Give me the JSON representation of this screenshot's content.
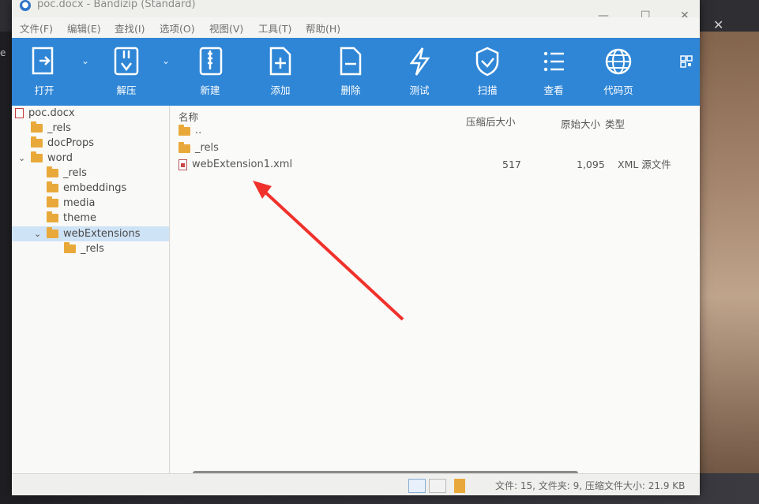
{
  "window": {
    "title": "poc.docx - Bandizip (Standard)",
    "min_glyph": "—",
    "max_glyph": "☐",
    "close_glyph": "✕"
  },
  "background": {
    "close_glyph": "✕",
    "side_label": "e"
  },
  "menu": [
    "文件(F)",
    "编辑(E)",
    "查找(I)",
    "选项(O)",
    "视图(V)",
    "工具(T)",
    "帮助(H)"
  ],
  "toolbar": {
    "items": [
      {
        "label": "打开",
        "icon": "open-icon"
      },
      {
        "label": "解压",
        "icon": "extract-icon"
      },
      {
        "label": "新建",
        "icon": "new-archive-icon"
      },
      {
        "label": "添加",
        "icon": "add-file-icon"
      },
      {
        "label": "删除",
        "icon": "delete-file-icon"
      },
      {
        "label": "测试",
        "icon": "test-icon"
      },
      {
        "label": "扫描",
        "icon": "scan-shield-icon"
      },
      {
        "label": "查看",
        "icon": "view-list-icon"
      },
      {
        "label": "代码页",
        "icon": "globe-icon"
      }
    ],
    "dropdown_glyph": "⌄"
  },
  "tree": [
    {
      "label": "poc.docx",
      "type": "file",
      "depth": 0
    },
    {
      "label": "_rels",
      "type": "folder",
      "depth": 1
    },
    {
      "label": "docProps",
      "type": "folder",
      "depth": 1
    },
    {
      "label": "word",
      "type": "folder",
      "depth": 1
    },
    {
      "label": "_rels",
      "type": "folder",
      "depth": 2
    },
    {
      "label": "embeddings",
      "type": "folder",
      "depth": 2
    },
    {
      "label": "media",
      "type": "folder",
      "depth": 2
    },
    {
      "label": "theme",
      "type": "folder",
      "depth": 2
    },
    {
      "label": "webExtensions",
      "type": "folder",
      "depth": 2,
      "selected": true,
      "expanded": true
    },
    {
      "label": "_rels",
      "type": "folder",
      "depth": 3
    }
  ],
  "tree_twisty": {
    "word": "⌄",
    "webExtensions": "⌄"
  },
  "columns": {
    "name": "名称",
    "compressed": "压缩后大小",
    "original": "原始大小",
    "type": "类型"
  },
  "files": [
    {
      "name": "..",
      "type_icon": "folder",
      "compressed": "",
      "original": "",
      "type": ""
    },
    {
      "name": "_rels",
      "type_icon": "folder",
      "compressed": "",
      "original": "",
      "type": ""
    },
    {
      "name": "webExtension1.xml",
      "type_icon": "xml",
      "compressed": "517",
      "original": "1,095",
      "type": "XML 源文件"
    }
  ],
  "status": {
    "text": "文件: 15, 文件夹: 9, 压缩文件大小: 21.9 KB"
  },
  "annotation": {
    "arrow_color": "#f0312b"
  }
}
